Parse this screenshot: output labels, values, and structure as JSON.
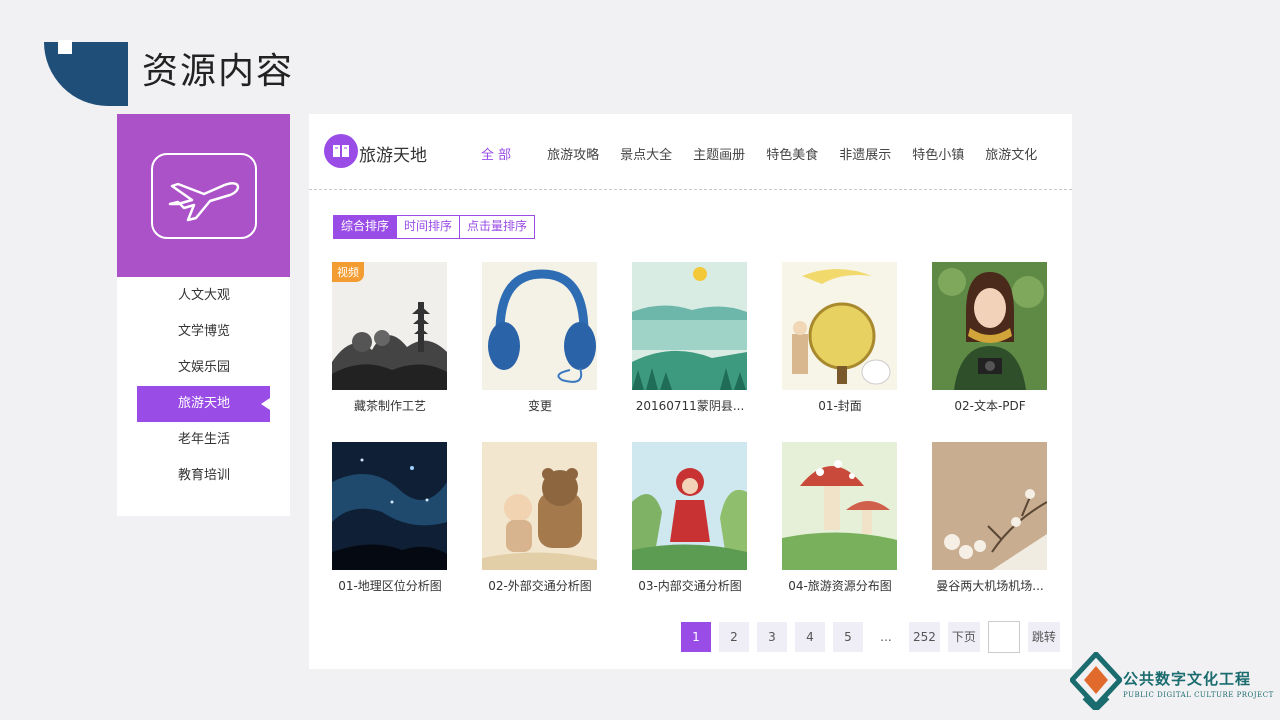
{
  "slide": {
    "title": "资源内容"
  },
  "sidebar": {
    "items": [
      {
        "label": "人文大观"
      },
      {
        "label": "文学博览"
      },
      {
        "label": "文娱乐园"
      },
      {
        "label": "旅游天地"
      },
      {
        "label": "老年生活"
      },
      {
        "label": "教育培训"
      }
    ],
    "active": "旅游天地"
  },
  "header": {
    "brand": "旅游天地",
    "tabs": [
      "全 部",
      "旅游攻略",
      "景点大全",
      "主题画册",
      "特色美食",
      "非遗展示",
      "特色小镇",
      "旅游文化"
    ],
    "active_tab": "全 部"
  },
  "sort": {
    "options": [
      "综合排序",
      "时间排序",
      "点击量排序"
    ],
    "active": "综合排序"
  },
  "grid": {
    "items": [
      {
        "title": "藏茶制作工艺",
        "badge": "视频"
      },
      {
        "title": "变更"
      },
      {
        "title": "20160711蒙阴县..."
      },
      {
        "title": "01-封面"
      },
      {
        "title": "02-文本-PDF"
      },
      {
        "title": "01-地理区位分析图"
      },
      {
        "title": "02-外部交通分析图"
      },
      {
        "title": "03-内部交通分析图"
      },
      {
        "title": "04-旅游资源分布图"
      },
      {
        "title": "曼谷两大机场机场..."
      }
    ]
  },
  "pagination": {
    "pages": [
      "1",
      "2",
      "3",
      "4",
      "5"
    ],
    "ellipsis": "...",
    "last": "252",
    "next": "下页",
    "jump": "跳转",
    "current": "1"
  },
  "logo": {
    "cn": "公共数字文化工程",
    "en": "PUBLIC DIGITAL CULTURE PROJECT"
  },
  "colors": {
    "accent": "#9a4de6",
    "hero": "#ab52c9",
    "header_shape": "#1f4e79",
    "badge": "#f39c31"
  }
}
